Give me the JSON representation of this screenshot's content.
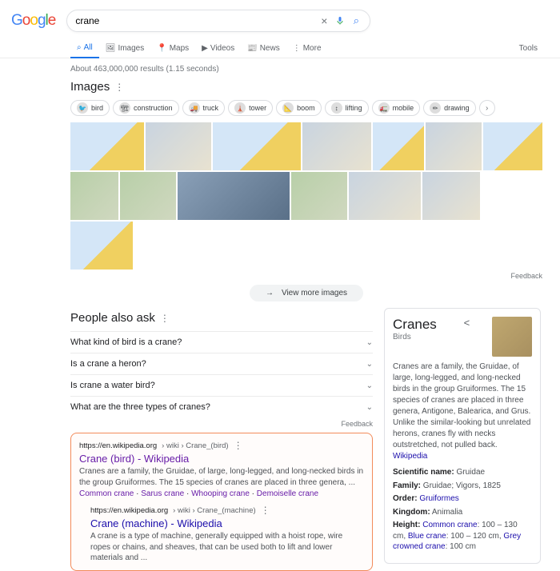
{
  "logo": [
    "G",
    "o",
    "o",
    "g",
    "l",
    "e"
  ],
  "search": {
    "value": "crane"
  },
  "tabs": [
    {
      "label": "All",
      "icon": "🔍"
    },
    {
      "label": "Images",
      "icon": "🖼"
    },
    {
      "label": "Maps",
      "icon": "📍"
    },
    {
      "label": "Videos",
      "icon": "▶"
    },
    {
      "label": "News",
      "icon": "📰"
    },
    {
      "label": "More",
      "icon": "⋮"
    }
  ],
  "tools_label": "Tools",
  "stats": "About 463,000,000 results (1.15 seconds)",
  "images_section": {
    "title": "Images",
    "chips": [
      "bird",
      "construction",
      "truck",
      "tower",
      "boom",
      "lifting",
      "mobile",
      "drawing"
    ],
    "feedback": "Feedback",
    "view_more": "View more images"
  },
  "paa": {
    "title": "People also ask",
    "questions": [
      "What kind of bird is a crane?",
      "Is a crane a heron?",
      "Is crane a water bird?",
      "What are the three types of cranes?"
    ],
    "feedback": "Feedback"
  },
  "results": [
    {
      "cite_host": "https://en.wikipedia.org",
      "cite_path": " › wiki › Crane_(bird)",
      "title": "Crane (bird) - Wikipedia",
      "snippet": "Cranes are a family, the Gruidae, of large, long-legged, and long-necked birds in the group Gruiformes. The 15 species of cranes are placed in three genera, ...",
      "sitelinks": [
        "Common crane",
        "Sarus crane",
        "Whooping crane",
        "Demoiselle crane"
      ]
    },
    {
      "cite_host": "https://en.wikipedia.org",
      "cite_path": " › wiki › Crane_(machine)",
      "title": "Crane (machine) - Wikipedia",
      "snippet": "A crane is a type of machine, generally equipped with a hoist rope, wire ropes or chains, and sheaves, that can be used both to lift and lower materials and ..."
    }
  ],
  "kp": {
    "title": "Cranes",
    "subtitle": "Birds",
    "desc": "Cranes are a family, the Gruidae, of large, long-legged, and long-necked birds in the group Gruiformes. The 15 species of cranes are placed in three genera, Antigone, Balearica, and Grus. Unlike the similar-looking but unrelated herons, cranes fly with necks outstretched, not pulled back.",
    "desc_link": "Wikipedia",
    "facts": {
      "scientific_name": {
        "k": "Scientific name:",
        "v": "Gruidae"
      },
      "family": {
        "k": "Family:",
        "v": "Gruidae; Vigors, 1825"
      },
      "order": {
        "k": "Order:",
        "v": "Gruiformes",
        "link": true
      },
      "kingdom": {
        "k": "Kingdom:",
        "v": "Animalia"
      },
      "height": {
        "k": "Height:",
        "parts": [
          {
            "t": "Common crane",
            "link": true
          },
          {
            "t": ": 100 – 130 cm, "
          },
          {
            "t": "Blue crane",
            "link": true
          },
          {
            "t": ": 100 – 120 cm, "
          },
          {
            "t": "Grey crowned crane",
            "link": true
          },
          {
            "t": ": 100 cm"
          }
        ]
      }
    }
  }
}
